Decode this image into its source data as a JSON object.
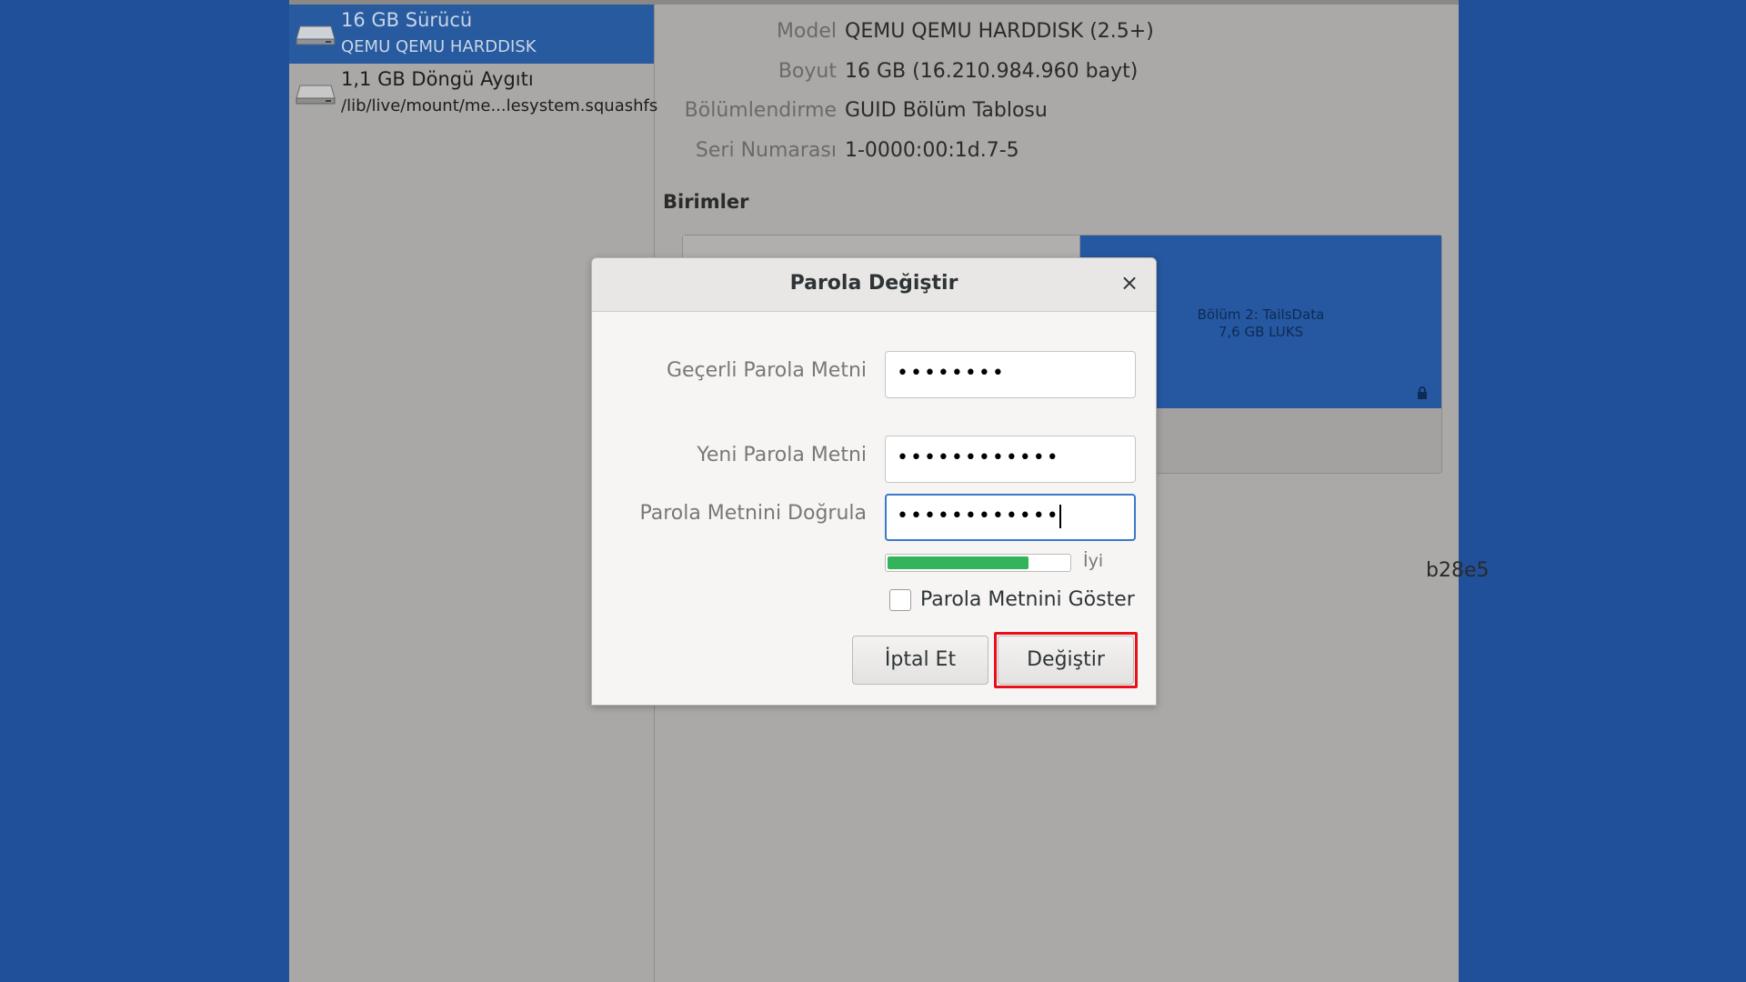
{
  "sidebar": {
    "drives": [
      {
        "name": "16 GB Sürücü",
        "sub": "QEMU QEMU HARDDISK",
        "selected": true,
        "icon": "harddisk-icon"
      },
      {
        "name": "1,1 GB Döngü Aygıtı",
        "sub": "/lib/live/mount/me...lesystem.squashfs",
        "selected": false,
        "icon": "harddisk-icon"
      }
    ]
  },
  "details": {
    "model_label": "Model",
    "model_value": "QEMU QEMU HARDDISK (2.5+)",
    "size_label": "Boyut",
    "size_value": "16 GB (16.210.984.960 bayt)",
    "partitioning_label": "Bölümlendirme",
    "partitioning_value": "GUID Bölüm Tablosu",
    "serial_label": "Seri Numarası",
    "serial_value": "1-0000:00:1d.7-5",
    "volumes_title": "Birimler",
    "partition_line1": "Bölüm 2: TailsData",
    "partition_line2": "7,6 GB LUKS",
    "uuid_fragment": "b28e5"
  },
  "dialog": {
    "title": "Parola Değiştir",
    "close_glyph": "×",
    "current_label": "Geçerli Parola Metni",
    "current_value": "••••••••",
    "new_label": "Yeni Parola Metni",
    "new_value": "••••••••••••",
    "confirm_label": "Parola Metnini Doğrula",
    "confirm_value": "••••••••••••",
    "strength_label": "İyi",
    "strength_fraction": 0.78,
    "show_label": "Parola Metnini Göster",
    "show_checked": false,
    "cancel_label": "İptal Et",
    "change_label": "Değiştir"
  },
  "colors": {
    "desktop": "#20509a",
    "selection": "#275a9e",
    "strength": "#33b35a",
    "highlight": "#e8101a"
  }
}
